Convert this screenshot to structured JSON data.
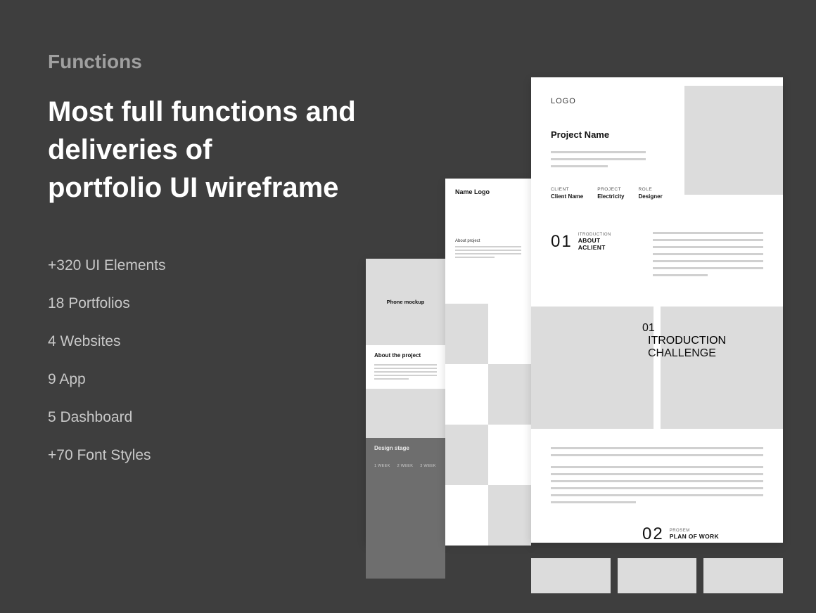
{
  "eyebrow": "Functions",
  "headline": "Most full functions and deliveries of\nportfolio UI wireframe",
  "features": [
    "+320 UI Elements",
    "18 Portfolios",
    "4 Websites",
    "9 App",
    "5 Dashboard",
    "+70 Font Styles"
  ],
  "card_a": {
    "logo": "LOGO",
    "project_name": "Project Name",
    "meta": [
      {
        "label": "CLIENT",
        "value": "Client Name"
      },
      {
        "label": "PROJECT",
        "value": "Electricity"
      },
      {
        "label": "ROLE",
        "value": "Designer"
      }
    ],
    "section1": {
      "num": "01",
      "label": "ITRODUCTION",
      "title": "ABOUT ACLIENT"
    },
    "section2": {
      "num": "01",
      "label": "ITRODUCTION",
      "title": "CHALLENGE"
    },
    "section3": {
      "num": "02",
      "label": "PROSEM",
      "title": "PLAN OF WORK"
    }
  },
  "card_b": {
    "logo": "Name Logo",
    "subtitle": "About project"
  },
  "card_c": {
    "mockup": "Phone mockup",
    "about": "About the project",
    "stage": "Design stage",
    "weeks": [
      "1 WEEK",
      "2 WEEK",
      "3 WEEK"
    ]
  }
}
